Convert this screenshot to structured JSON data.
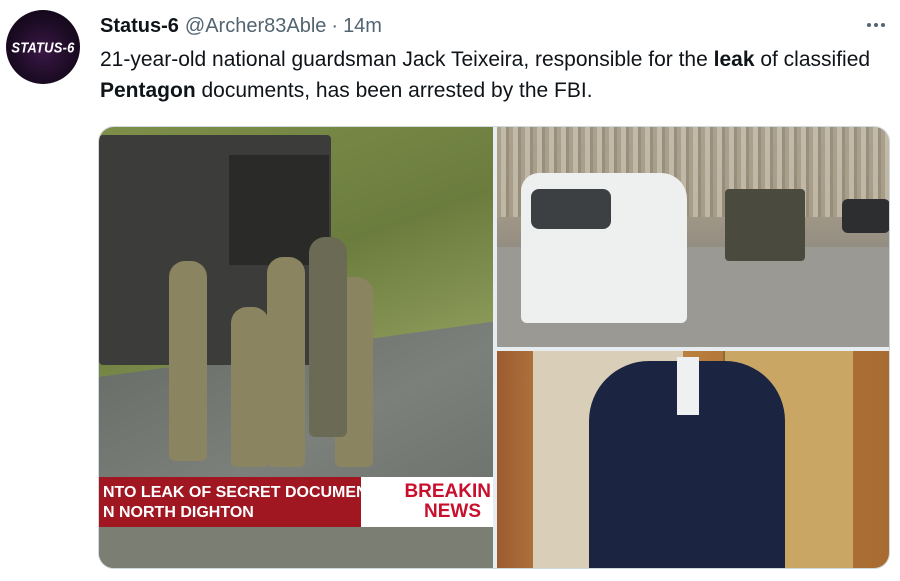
{
  "tweet": {
    "avatar_text": "STATUS-6",
    "display_name": "Status-6",
    "handle": "@Archer83Able",
    "separator": "·",
    "time": "14m",
    "more_icon": "more-horizontal-icon",
    "text": {
      "part1": "21-year-old national guardsman Jack Teixeira, responsible for the ",
      "bold1": "leak",
      "part2": " of classified ",
      "bold2": "Pentagon",
      "part3": " documents, has been arrested by the FBI."
    },
    "media": {
      "photo1": {
        "ticker_line1": "NTO LEAK OF SECRET DOCUMENTS",
        "ticker_line2": "N NORTH DIGHTON",
        "breaking": "BREAKIN",
        "news": "NEWS"
      }
    }
  },
  "colors": {
    "text_primary": "#0f1419",
    "text_secondary": "#536471",
    "ticker_red": "#a01722",
    "breaking_red": "#c8102e"
  }
}
